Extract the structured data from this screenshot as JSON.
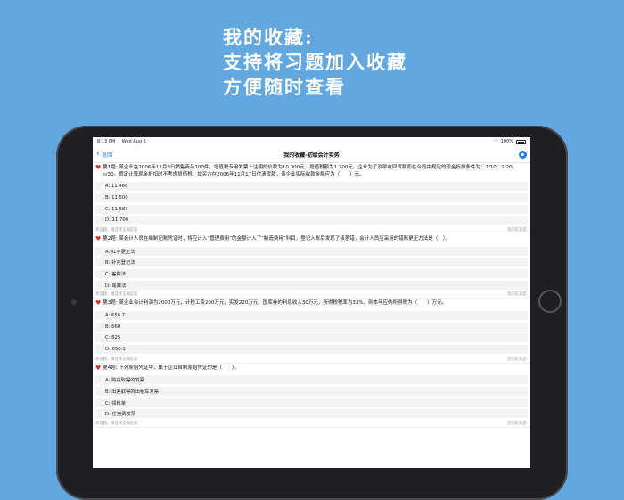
{
  "promo": {
    "line1": "我的收藏:",
    "line2": "支持将习题加入收藏",
    "line3": "方便随时查看"
  },
  "status": {
    "time": "8:13 PM",
    "date": "Wed Aug 5",
    "battery": "100%"
  },
  "nav": {
    "back_label": "返回",
    "title": "我的收藏-初级会计实务"
  },
  "questions": [
    {
      "text": "第1题: 某企业在2006年11月8日销售商品100件，增值税专用发票上注明的价款为10 000元，增值税额为1 700元。企业为了及早收回货款而在合同中规定的现金折扣条件为：2/10，1/20，n/30。假定计算现金折扣时不考虑增值税。如买方在2006年11月17日付清货款，该企业实际收款金额应为（　　）元。",
      "options": [
        "A: 11 466",
        "B: 11 500",
        "C: 11 583",
        "D: 11 700"
      ],
      "footer_left": "单选题，请选择正确答案",
      "footer_right": "您的答案是:"
    },
    {
      "text": "第2题: 某会计人员在编制记账凭证时，将应计入“管理费用”的金额计入了“制造费用”科目，登记入账后发现了该差错，会计人员应采用的错账更正方法是（　）。",
      "options": [
        "A: 红字更正法",
        "B: 补充登记法",
        "C: 差数法",
        "D: 尾数法"
      ],
      "footer_left": "单选题，请选择正确答案",
      "footer_right": "您的答案是:"
    },
    {
      "text": "第3题: 某企业会计利润为2000万元，计税工资200万元，实发220万元，国库券的利息收入30万元，所得税税率为33%，则本年应纳所得税为（　　）万元。",
      "options": [
        "A: 656.7",
        "B: 660",
        "C: 825",
        "D: 650.1"
      ],
      "footer_left": "单选题，请选择正确答案",
      "footer_right": "您的答案是:"
    },
    {
      "text": "第4题: 下列原始凭证中，属于企业自制原始凭证的是（　　）。",
      "options": [
        "A: 购货取得的发票",
        "B: 出差取得的出租车发票",
        "C: 领料单",
        "D: 住宿费发票"
      ],
      "footer_left": "单选题，请选择正确答案",
      "footer_right": "您的答案是:"
    }
  ]
}
